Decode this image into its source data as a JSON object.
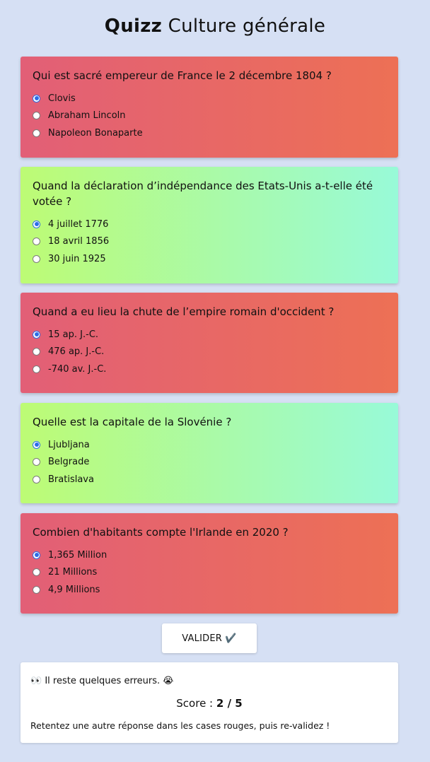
{
  "header": {
    "title_bold": "Quizz",
    "title_rest": "Culture générale"
  },
  "questions": [
    {
      "text": "Qui est sacré empereur de France le 2 décembre 1804 ?",
      "status": "wrong",
      "options": [
        "Clovis",
        "Abraham Lincoln",
        "Napoleon Bonaparte"
      ],
      "selected": 0
    },
    {
      "text": "Quand la déclaration d’indépendance des Etats-Unis a-t-elle été votée ?",
      "status": "right",
      "options": [
        "4 juillet 1776",
        "18 avril 1856",
        "30 juin 1925"
      ],
      "selected": 0
    },
    {
      "text": "Quand a eu lieu la chute de l’empire romain d'occident ?",
      "status": "wrong",
      "options": [
        "15 ap. J.-C.",
        "476 ap. J.-C.",
        "-740 av. J.-C."
      ],
      "selected": 0
    },
    {
      "text": "Quelle est la capitale de la Slovénie ?",
      "status": "right",
      "options": [
        "Ljubljana",
        "Belgrade",
        "Bratislava"
      ],
      "selected": 0
    },
    {
      "text": "Combien d'habitants compte l'Irlande en 2020 ?",
      "status": "wrong",
      "options": [
        "1,365 Million",
        "21 Millions",
        "4,9 Millions"
      ],
      "selected": 0
    }
  ],
  "validate": {
    "label": "VALIDER ✔️"
  },
  "result": {
    "message": "👀 Il reste quelques erreurs. 😭",
    "score_label": "Score :",
    "score_value": "2 / 5",
    "hint": "Retentez une autre réponse dans les cases rouges, puis re-validez !"
  },
  "colors": {
    "wrong_gradient_start": "#e25f77",
    "wrong_gradient_end": "#ed7055",
    "right_gradient_start": "#bdfb74",
    "right_gradient_end": "#98fad8",
    "background": "#d6e0f4",
    "radio_accent": "#2a6de8"
  },
  "icons": {
    "validate": "check-mark-icon"
  }
}
